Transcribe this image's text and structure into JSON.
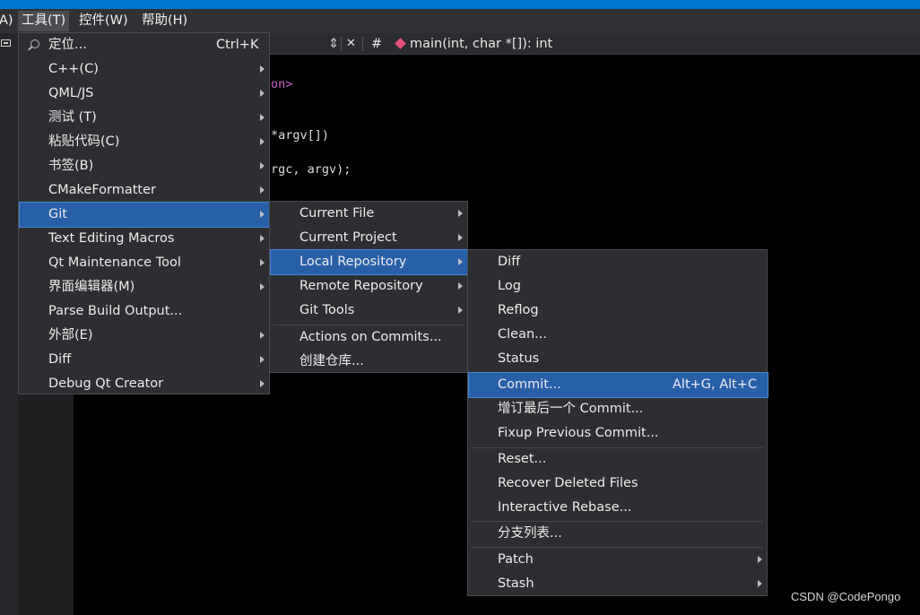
{
  "menubar": {
    "partial": "A)",
    "tools": "工具(T)",
    "controls": "控件(W)",
    "help": "帮助(H)"
  },
  "toolbar": {
    "combo_arrows": "⇕",
    "close": "✕",
    "hash": "#",
    "function": "main(int, char *[]): int"
  },
  "code": {
    "line1": "on>",
    "line2": "*argv[])",
    "line3": "rgc, argv);"
  },
  "tools_menu": {
    "items": [
      {
        "label": "定位...",
        "shortcut": "Ctrl+K"
      },
      {
        "label": "C++(C)"
      },
      {
        "label": "QML/JS"
      },
      {
        "label": "测试 (T)"
      },
      {
        "label": "粘贴代码(C)"
      },
      {
        "label": "书签(B)"
      },
      {
        "label": "CMakeFormatter"
      },
      {
        "label": "Git"
      },
      {
        "label": "Text Editing Macros"
      },
      {
        "label": "Qt Maintenance Tool"
      },
      {
        "label": "界面编辑器(M)"
      },
      {
        "label": "Parse Build Output..."
      },
      {
        "label": "外部(E)"
      },
      {
        "label": "Diff"
      },
      {
        "label": "Debug Qt Creator"
      }
    ]
  },
  "git_menu": {
    "items": [
      {
        "label": "Current File"
      },
      {
        "label": "Current Project"
      },
      {
        "label": "Local Repository"
      },
      {
        "label": "Remote Repository"
      },
      {
        "label": "Git Tools"
      },
      {
        "label": "Actions on Commits..."
      },
      {
        "label": "创建仓库..."
      }
    ]
  },
  "local_repo_menu": {
    "items": [
      {
        "label": "Diff"
      },
      {
        "label": "Log"
      },
      {
        "label": "Reflog"
      },
      {
        "label": "Clean..."
      },
      {
        "label": "Status"
      },
      {
        "label": "Commit...",
        "shortcut": "Alt+G, Alt+C"
      },
      {
        "label": "增订最后一个 Commit..."
      },
      {
        "label": "Fixup Previous Commit..."
      },
      {
        "label": "Reset..."
      },
      {
        "label": "Recover Deleted Files"
      },
      {
        "label": "Interactive Rebase..."
      },
      {
        "label": "分支列表..."
      },
      {
        "label": "Patch"
      },
      {
        "label": "Stash"
      }
    ]
  },
  "watermark": "CSDN @CodePongo"
}
